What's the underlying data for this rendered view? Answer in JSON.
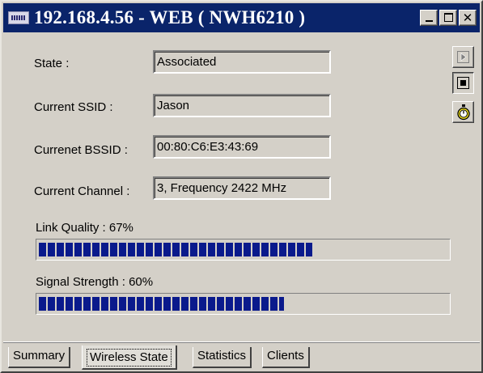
{
  "window": {
    "title": "192.168.4.56 - WEB ( NWH6210 )",
    "app_icon": "wireless-app-icon",
    "title_bar_color": "#0a246a",
    "controls": {
      "minimize": "minimize-icon",
      "maximize": "maximize-icon",
      "close": "close-icon",
      "close_glyph": "✕"
    }
  },
  "fields": {
    "state": {
      "label": "State :",
      "value": "Associated"
    },
    "ssid": {
      "label": "Current SSID :",
      "value": "Jason"
    },
    "bssid": {
      "label": "Currenet BSSID :",
      "value": "00:80:C6:E3:43:69"
    },
    "channel": {
      "label": "Current Channel :",
      "value": "3, Frequency 2422 MHz"
    }
  },
  "link_quality": {
    "label": "Link Quality : 67%",
    "percent": 67
  },
  "signal_strength": {
    "label": "Signal Strength : 60%",
    "percent": 60
  },
  "progress_color": "#0a1a8c",
  "side_buttons": [
    {
      "icon": "play-icon",
      "state": "disabled"
    },
    {
      "icon": "stop-icon",
      "state": "pressed"
    },
    {
      "icon": "stopwatch-icon",
      "state": "normal"
    }
  ],
  "tabs": [
    {
      "label": "Summary",
      "active": false
    },
    {
      "label": "Wireless State",
      "active": true
    },
    {
      "label": "Statistics",
      "active": false
    },
    {
      "label": "Clients",
      "active": false
    }
  ]
}
